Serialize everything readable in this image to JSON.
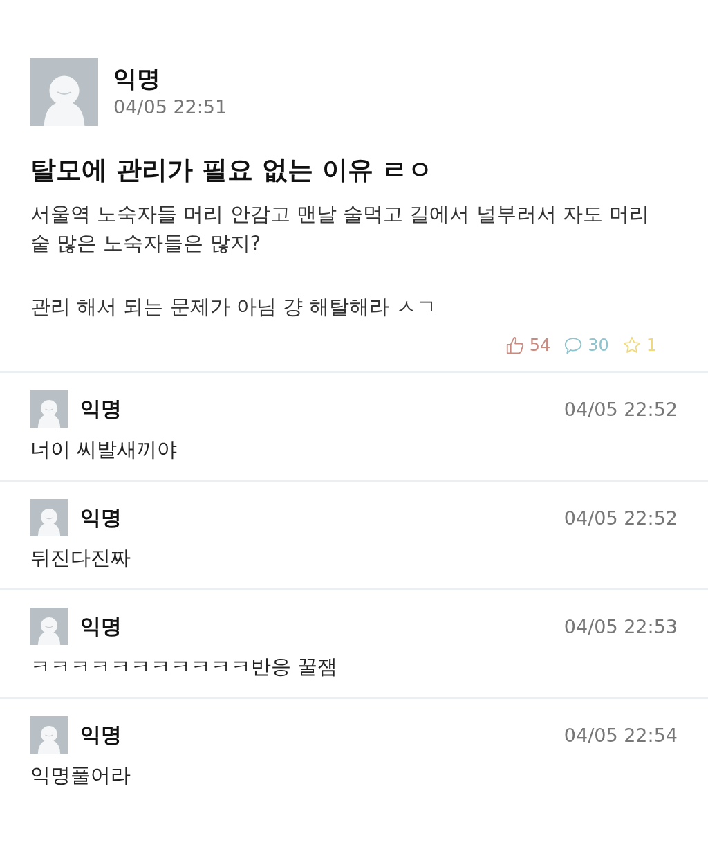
{
  "post": {
    "author": "익명",
    "time": "04/05 22:51",
    "title": "탈모에 관리가 필요 없는 이유 ㄹㅇ",
    "paragraphs": [
      "서울역 노숙자들 머리 안감고 맨날 술먹고 길에서 널부러서 자도 머리숱 많은 노숙자들은 많지?",
      "관리 해서 되는 문제가 아님 걍 해탈해라 ㅅㄱ"
    ],
    "stats": [
      {
        "kind": "like",
        "count": "54",
        "color": "#c98a80"
      },
      {
        "kind": "comment",
        "count": "30",
        "color": "#8cc4cf"
      },
      {
        "kind": "scrap",
        "count": "1",
        "color": "#f0d97a"
      }
    ]
  },
  "comments": [
    {
      "author": "익명",
      "time": "04/05 22:52",
      "text": "너이 씨발새끼야"
    },
    {
      "author": "익명",
      "time": "04/05 22:52",
      "text": "뒤진다진짜"
    },
    {
      "author": "익명",
      "time": "04/05 22:53",
      "text": "ㅋㅋㅋㅋㅋㅋㅋㅋㅋㅋㅋ반응 꿀잼"
    },
    {
      "author": "익명",
      "time": "04/05 22:54",
      "text": "익명풀어라"
    }
  ]
}
